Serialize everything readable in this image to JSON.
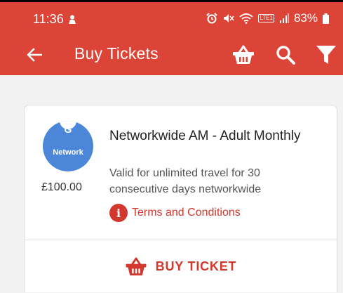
{
  "status_bar": {
    "time": "11:36",
    "battery": "83%",
    "network_label": "LTE1",
    "icons": [
      "person-icon",
      "alarm-icon",
      "mute-icon",
      "wifi-icon",
      "volte-icon",
      "signal-icon",
      "battery-icon"
    ]
  },
  "app_bar": {
    "title": "Buy Tickets",
    "background": "#db4437",
    "icons": [
      "back-arrow-icon",
      "basket-icon",
      "search-icon",
      "filter-icon"
    ]
  },
  "ticket": {
    "logo_letter": "G",
    "logo_text": "Network",
    "logo_color": "#4b86d8",
    "price": "£100.00",
    "name": "Networkwide AM - Adult Monthly",
    "description": "Valid for unlimited travel for 30 consecutive days networkwide",
    "terms_icon": "i",
    "terms_label": "Terms and Conditions",
    "buy_label": "BUY TICKET",
    "accent": "#d2382d"
  }
}
